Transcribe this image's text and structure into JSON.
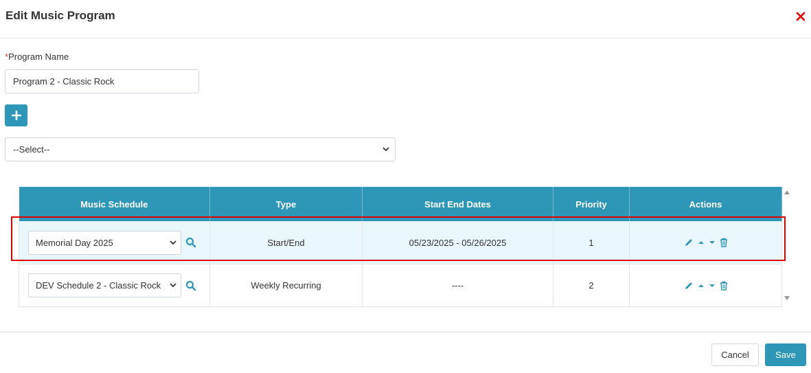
{
  "dialog": {
    "title": "Edit Music Program"
  },
  "form": {
    "program_name_label": "Program Name",
    "required_marker": "*",
    "program_name_value": "Program 2 - Classic Rock",
    "add_label": "+",
    "select_value": "--Select--"
  },
  "table": {
    "headers": [
      "Music Schedule",
      "Type",
      "Start End Dates",
      "Priority",
      "Actions"
    ],
    "rows": [
      {
        "schedule": "Memorial Day 2025",
        "type": "Start/End",
        "dates": "05/23/2025 - 05/26/2025",
        "priority": "1",
        "highlighted": true
      },
      {
        "schedule": "DEV Schedule 2 - Classic Rock",
        "type": "Weekly Recurring",
        "dates": "----",
        "priority": "2",
        "highlighted": false
      }
    ]
  },
  "footer": {
    "cancel_label": "Cancel",
    "save_label": "Save"
  },
  "icons": {
    "close": "close-icon",
    "search": "search-icon",
    "edit": "pencil-icon",
    "move_up": "caret-up-icon",
    "move_down": "caret-down-icon",
    "delete": "trash-icon"
  },
  "colors": {
    "accent": "#2e97b7",
    "close": "#e00000",
    "highlight_border": "#e00000",
    "row_highlight_bg": "#e9f6fb"
  }
}
